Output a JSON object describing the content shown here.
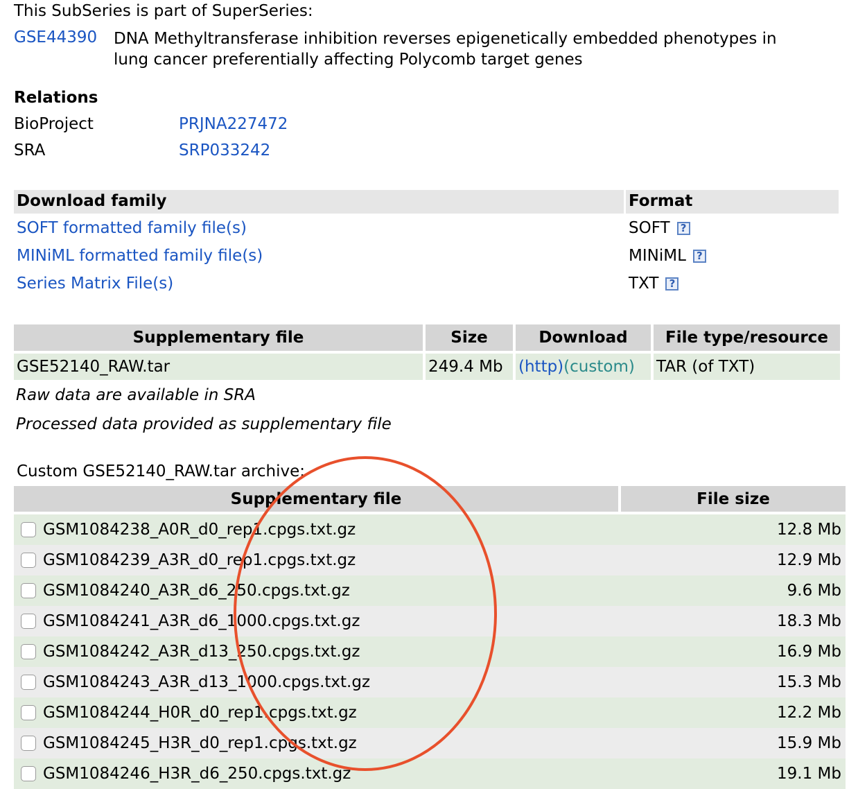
{
  "superseries": {
    "heading": "This SubSeries is part of SuperSeries:",
    "accession": "GSE44390",
    "title_line1": "DNA Methyltransferase inhibition reverses epigenetically embedded phenotypes in",
    "title_line2": "lung cancer preferentially affecting Polycomb target genes"
  },
  "relations": {
    "heading": "Relations",
    "items": [
      {
        "label": "BioProject",
        "value": "PRJNA227472"
      },
      {
        "label": "SRA",
        "value": "SRP033242"
      }
    ]
  },
  "download_family": {
    "col_download": "Download family",
    "col_format": "Format",
    "rows": [
      {
        "link": "SOFT formatted family file(s)",
        "format": "SOFT"
      },
      {
        "link": "MINiML formatted family file(s)",
        "format": "MINiML"
      },
      {
        "link": "Series Matrix File(s)",
        "format": "TXT"
      }
    ],
    "help_glyph": "?"
  },
  "supplementary": {
    "headers": [
      "Supplementary file",
      "Size",
      "Download",
      "File type/resource"
    ],
    "row": {
      "file": "GSE52140_RAW.tar",
      "size": "249.4 Mb",
      "http": "(http)",
      "custom": "(custom)",
      "type": "TAR (of TXT)"
    },
    "note1": "Raw data are available in SRA",
    "note2": "Processed data provided as supplementary file"
  },
  "archive": {
    "caption": "Custom GSE52140_RAW.tar archive:",
    "col_file": "Supplementary file",
    "col_size": "File size",
    "rows": [
      {
        "file": "GSM1084238_A0R_d0_rep1.cpgs.txt.gz",
        "size": "12.8 Mb"
      },
      {
        "file": "GSM1084239_A3R_d0_rep1.cpgs.txt.gz",
        "size": "12.9 Mb"
      },
      {
        "file": "GSM1084240_A3R_d6_250.cpgs.txt.gz",
        "size": "9.6 Mb"
      },
      {
        "file": "GSM1084241_A3R_d6_1000.cpgs.txt.gz",
        "size": "18.3 Mb"
      },
      {
        "file": "GSM1084242_A3R_d13_250.cpgs.txt.gz",
        "size": "16.9 Mb"
      },
      {
        "file": "GSM1084243_A3R_d13_1000.cpgs.txt.gz",
        "size": "15.3 Mb"
      },
      {
        "file": "GSM1084244_H0R_d0_rep1.cpgs.txt.gz",
        "size": "12.2 Mb"
      },
      {
        "file": "GSM1084245_H3R_d0_rep1.cpgs.txt.gz",
        "size": "15.9 Mb"
      },
      {
        "file": "GSM1084246_H3R_d6_250.cpgs.txt.gz",
        "size": "19.1 Mb"
      }
    ]
  },
  "colors": {
    "link": "#1a55c2",
    "annotation_circle": "#e8502c",
    "header_grey": "#d5d5d5",
    "row_green": "#e2ecdf",
    "row_grey": "#ececec"
  }
}
